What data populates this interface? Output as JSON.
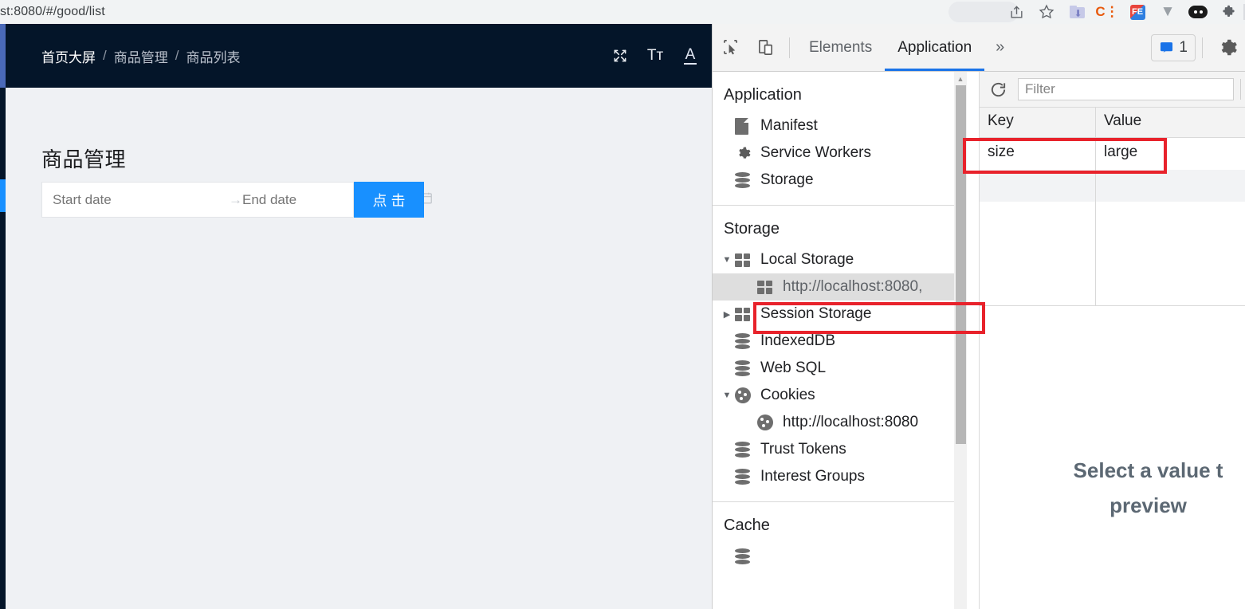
{
  "browser": {
    "url": "st:8080/#/good/list",
    "extensions": [
      {
        "name": "share-icon",
        "glyph": "➦"
      },
      {
        "name": "bookmark-star-icon",
        "glyph": "☆"
      },
      {
        "name": "download-folder-icon",
        "glyph": ""
      },
      {
        "name": "c-colon-extension-icon",
        "glyph": "C⋮"
      },
      {
        "name": "fe-extension-icon",
        "glyph": "FE"
      },
      {
        "name": "vue-devtools-icon",
        "glyph": "▼"
      },
      {
        "name": "oval-extension-icon",
        "glyph": ""
      },
      {
        "name": "puzzle-extensions-icon",
        "glyph": "✦"
      }
    ]
  },
  "app": {
    "breadcrumb": {
      "items": [
        "首页大屏",
        "商品管理",
        "商品列表"
      ],
      "separator": "/"
    },
    "header_tools": [
      {
        "name": "fullscreen-icon",
        "glyph": "⤢"
      },
      {
        "name": "font-size-icon",
        "glyph": "Tт"
      },
      {
        "name": "theme-color-icon",
        "glyph": "A"
      }
    ],
    "page_title": "商品管理",
    "date_range": {
      "start_placeholder": "Start date",
      "end_placeholder": "End date",
      "start_value": "",
      "end_value": "",
      "arrow": "→",
      "calendar_icon": "Ὄ5"
    },
    "submit_button": "点击",
    "accent_color": "#1890ff",
    "header_bg": "#041529"
  },
  "devtools": {
    "toolbar": {
      "inspect_icon": "inspect-element-icon",
      "device_icon": "device-toolbar-icon",
      "tabs": [
        {
          "label": "Elements",
          "active": false
        },
        {
          "label": "Application",
          "active": true
        }
      ],
      "more_tabs": "»",
      "message_count": "1",
      "settings_icon": "gear-icon"
    },
    "tree": [
      {
        "section": "Application",
        "items": [
          {
            "label": "Manifest",
            "icon": "document-icon",
            "twisty": "",
            "indent": 1,
            "selected": false
          },
          {
            "label": "Service Workers",
            "icon": "gear-icon",
            "twisty": "",
            "indent": 1,
            "selected": false
          },
          {
            "label": "Storage",
            "icon": "database-icon",
            "twisty": "",
            "indent": 1,
            "selected": false
          }
        ]
      },
      {
        "section": "Storage",
        "items": [
          {
            "label": "Local Storage",
            "icon": "grid-icon",
            "twisty": "▼",
            "indent": 1,
            "selected": false
          },
          {
            "label": "http://localhost:8080,",
            "icon": "grid-icon",
            "twisty": "",
            "indent": 2,
            "selected": true
          },
          {
            "label": "Session Storage",
            "icon": "grid-icon",
            "twisty": "▶",
            "indent": 1,
            "selected": false
          },
          {
            "label": "IndexedDB",
            "icon": "database-icon",
            "twisty": "",
            "indent": 1,
            "selected": false
          },
          {
            "label": "Web SQL",
            "icon": "database-icon",
            "twisty": "",
            "indent": 1,
            "selected": false
          },
          {
            "label": "Cookies",
            "icon": "cookie-icon",
            "twisty": "▼",
            "indent": 1,
            "selected": false
          },
          {
            "label": "http://localhost:8080",
            "icon": "cookie-icon",
            "twisty": "",
            "indent": 2,
            "selected": false
          },
          {
            "label": "Trust Tokens",
            "icon": "database-icon",
            "twisty": "",
            "indent": 1,
            "selected": false
          },
          {
            "label": "Interest Groups",
            "icon": "database-icon",
            "twisty": "",
            "indent": 1,
            "selected": false
          }
        ]
      },
      {
        "section": "Cache",
        "items": []
      }
    ],
    "table": {
      "refresh_icon": "refresh-icon",
      "filter_placeholder": "Filter",
      "filter_value": "",
      "columns": [
        "Key",
        "Value"
      ],
      "rows": [
        {
          "key": "size",
          "value": "large",
          "highlighted": true
        }
      ],
      "preview_line1": "Select a value t",
      "preview_line2": "preview"
    },
    "annotation_color": "#e8222b"
  }
}
